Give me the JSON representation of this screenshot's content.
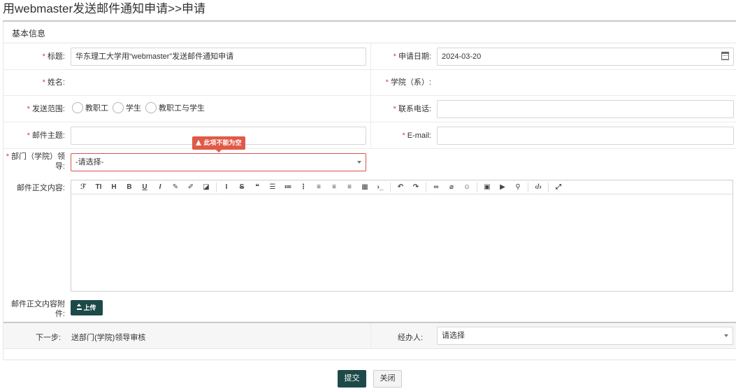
{
  "page": {
    "title": "用webmaster发送邮件通知申请>>申请"
  },
  "section": {
    "title": "基本信息"
  },
  "form": {
    "subject": {
      "label": "标题:",
      "value": "华东理工大学用“webmaster”发送邮件通知申请"
    },
    "apply_date": {
      "label": "申请日期:",
      "value": "2024-03-20"
    },
    "name": {
      "label": "姓名:"
    },
    "college": {
      "label": "学院（系）:"
    },
    "scope": {
      "label": "发送范围:",
      "options": [
        "教职工",
        "学生",
        "教职工与学生"
      ]
    },
    "phone": {
      "label": "联系电话:"
    },
    "mail_subject": {
      "label": "邮件主题:"
    },
    "email": {
      "label": "E-mail:"
    },
    "dept_leader": {
      "label": "部门（学院）领导:",
      "placeholder": "-请选择-",
      "error": "此项不能为空"
    },
    "body": {
      "label": "邮件正文内容:"
    },
    "attachment": {
      "label": "邮件正文内容附件:",
      "upload_label": "上传"
    }
  },
  "toolbar": {
    "icons": [
      "font-icon",
      "font-size-icon",
      "heading-icon",
      "bold-icon",
      "underline-icon",
      "italic-icon",
      "color-icon",
      "background-color-icon",
      "eraser-icon",
      "text-cursor-icon",
      "strikethrough-icon",
      "quote-icon",
      "ordered-list-icon",
      "bullet-list-icon",
      "number-list-icon",
      "align-left-icon",
      "align-center-icon",
      "align-right-icon",
      "table-icon",
      "code-icon",
      "undo-icon",
      "redo-icon",
      "link-icon",
      "unlink-icon",
      "emoji-icon",
      "image-icon",
      "video-icon",
      "location-icon",
      "source-code-icon",
      "fullscreen-icon"
    ]
  },
  "next_step": {
    "label": "下一步:",
    "value": "送部门(学院)领导审核"
  },
  "handler": {
    "label": "经办人:",
    "placeholder": "请选择"
  },
  "actions": {
    "submit": "提交",
    "close": "关闭"
  },
  "colors": {
    "primary": "#1d4a48",
    "required": "#e4393c",
    "error": "#e05a47"
  }
}
